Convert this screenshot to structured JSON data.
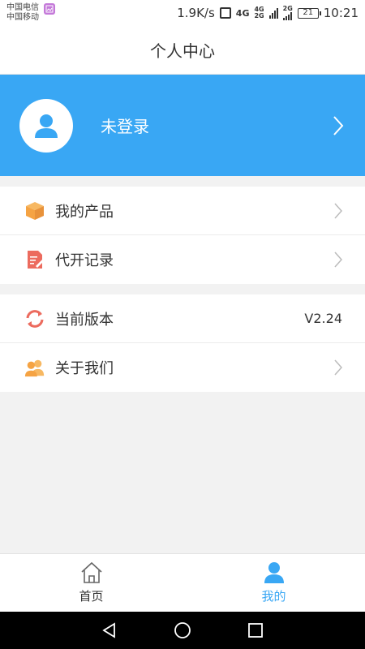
{
  "status_bar": {
    "carrier_1": "中国电信",
    "carrier_2": "中国移动",
    "net_speed": "1.9K/s",
    "net_type_1": "4G",
    "net_type_2": "4G",
    "net_type_3": "2G",
    "net_type_4": "2G",
    "battery": "21",
    "time": "10:21"
  },
  "header": {
    "title": "个人中心"
  },
  "profile": {
    "login_status": "未登录"
  },
  "menu_group_1": [
    {
      "label": "我的产品",
      "icon": "box-icon"
    },
    {
      "label": "代开记录",
      "icon": "document-edit-icon"
    }
  ],
  "menu_group_2": [
    {
      "label": "当前版本",
      "icon": "refresh-icon",
      "value": "V2.24"
    },
    {
      "label": "关于我们",
      "icon": "users-icon"
    }
  ],
  "tabbar": {
    "home_label": "首页",
    "mine_label": "我的"
  },
  "colors": {
    "accent": "#39a7f4",
    "orange": "#f5a343",
    "red": "#ec6b5e"
  }
}
